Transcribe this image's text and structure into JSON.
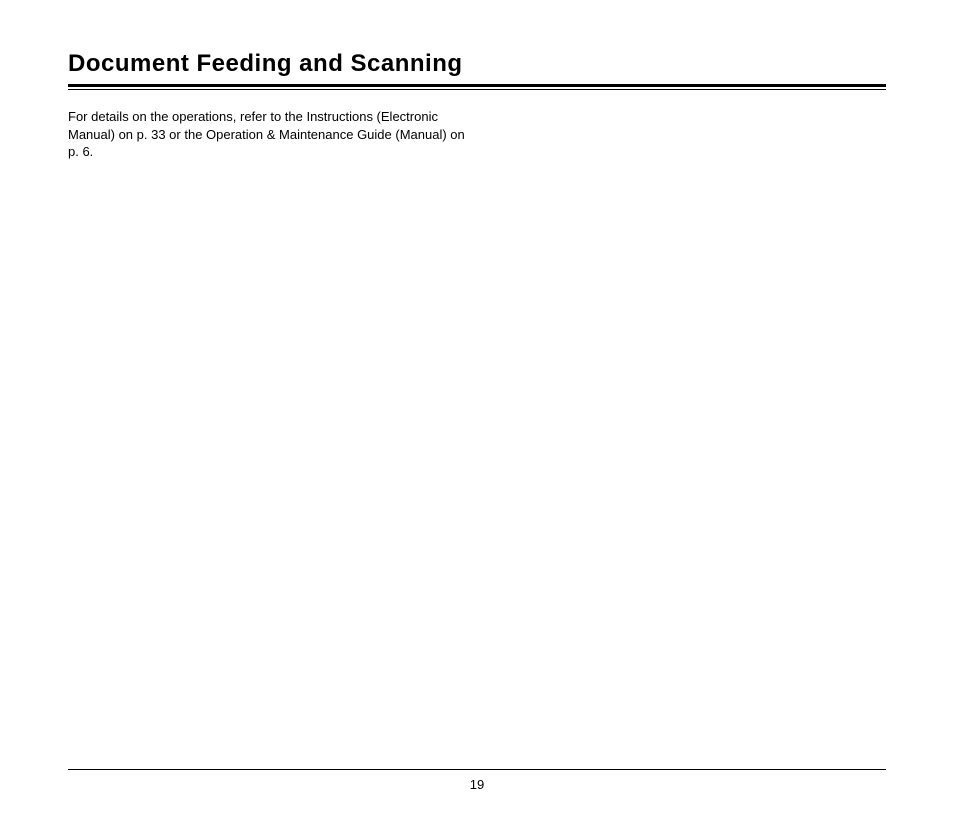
{
  "section": {
    "title": "Document Feeding and Scanning",
    "body": "For details on the operations, refer to the Instructions (Electronic Manual) on p. 33 or the Operation & Maintenance Guide (Manual) on p. 6."
  },
  "footer": {
    "page_number": "19"
  }
}
